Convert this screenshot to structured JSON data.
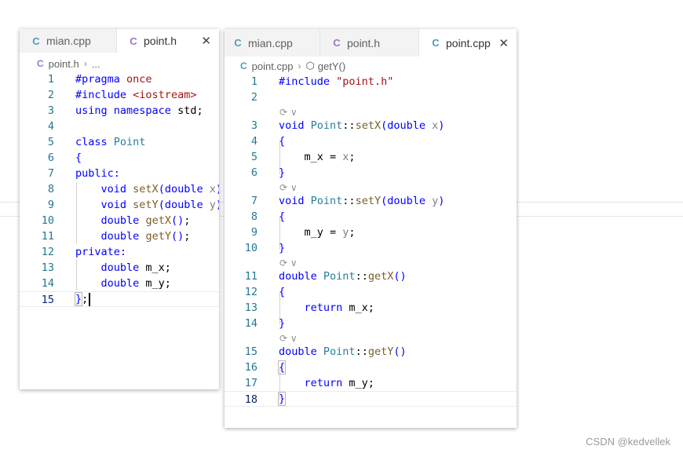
{
  "left_window": {
    "tabs": [
      {
        "icon": "C",
        "icon_kind": "cpp",
        "label": "mian.cpp",
        "active": false
      },
      {
        "icon": "C",
        "icon_kind": "h",
        "label": "point.h",
        "active": true,
        "close": "✕"
      }
    ],
    "breadcrumb": {
      "icon": "C",
      "file": "point.h",
      "separator": "›",
      "rest": "..."
    },
    "lines": [
      {
        "n": "1",
        "code": "#pragma once"
      },
      {
        "n": "2",
        "code": "#include <iostream>"
      },
      {
        "n": "3",
        "code": "using namespace std;"
      },
      {
        "n": "4",
        "code": ""
      },
      {
        "n": "5",
        "code": "class Point"
      },
      {
        "n": "6",
        "code": "{"
      },
      {
        "n": "7",
        "code": "public:"
      },
      {
        "n": "8",
        "code": "    void setX(double x);"
      },
      {
        "n": "9",
        "code": "    void setY(double y);"
      },
      {
        "n": "10",
        "code": "    double getX();"
      },
      {
        "n": "11",
        "code": "    double getY();"
      },
      {
        "n": "12",
        "code": "private:"
      },
      {
        "n": "13",
        "code": "    double m_x;"
      },
      {
        "n": "14",
        "code": "    double m_y;"
      },
      {
        "n": "15",
        "code": "};"
      }
    ]
  },
  "right_window": {
    "tabs": [
      {
        "icon": "C",
        "icon_kind": "cpp",
        "label": "mian.cpp",
        "active": false
      },
      {
        "icon": "C",
        "icon_kind": "h",
        "label": "point.h",
        "active": false
      },
      {
        "icon": "C",
        "icon_kind": "cpp",
        "label": "point.cpp",
        "active": true,
        "close": "✕"
      }
    ],
    "breadcrumb": {
      "icon": "C",
      "file": "point.cpp",
      "separator": "›",
      "symbol_icon": "⬡",
      "symbol": "getY()"
    },
    "codelens": "⟳ ∨",
    "lines": [
      {
        "n": "1",
        "code": "#include \"point.h\""
      },
      {
        "n": "2",
        "code": ""
      },
      {
        "n": "3",
        "code": "void Point::setX(double x)"
      },
      {
        "n": "4",
        "code": "{"
      },
      {
        "n": "5",
        "code": "    m_x = x;"
      },
      {
        "n": "6",
        "code": "}"
      },
      {
        "n": "7",
        "code": "void Point::setY(double y)"
      },
      {
        "n": "8",
        "code": "{"
      },
      {
        "n": "9",
        "code": "    m_y = y;"
      },
      {
        "n": "10",
        "code": "}"
      },
      {
        "n": "11",
        "code": "double Point::getX()"
      },
      {
        "n": "12",
        "code": "{"
      },
      {
        "n": "13",
        "code": "    return m_x;"
      },
      {
        "n": "14",
        "code": "}"
      },
      {
        "n": "15",
        "code": "double Point::getY()"
      },
      {
        "n": "16",
        "code": "{"
      },
      {
        "n": "17",
        "code": "    return m_y;"
      },
      {
        "n": "18",
        "code": "}"
      }
    ]
  },
  "watermark": "CSDN @kedvellek",
  "colors": {
    "keyword": "#0000ff",
    "string": "#a31515",
    "type": "#267f99",
    "function": "#795e26",
    "parameter": "#001080",
    "line_number": "#237893"
  }
}
